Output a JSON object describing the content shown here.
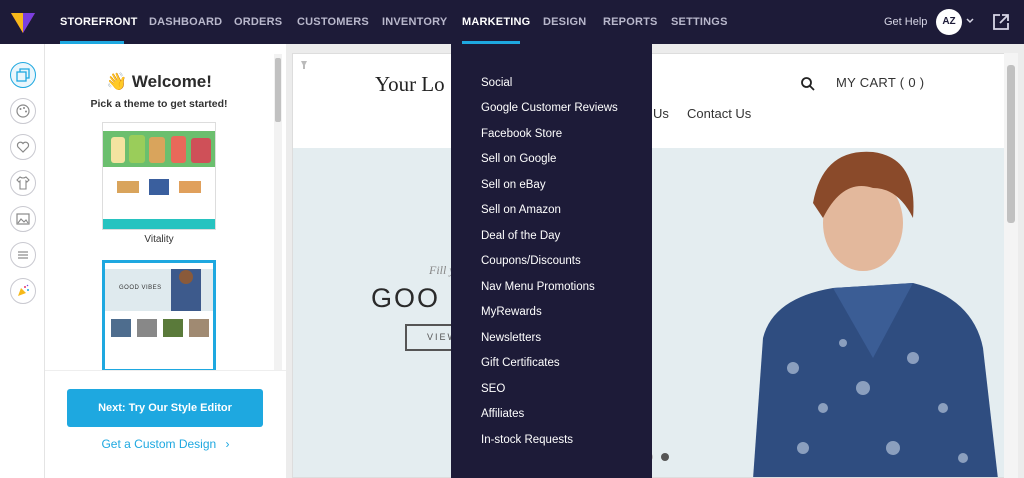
{
  "nav": {
    "items": [
      "STOREFRONT",
      "DASHBOARD",
      "ORDERS",
      "CUSTOMERS",
      "INVENTORY",
      "MARKETING",
      "DESIGN",
      "REPORTS",
      "SETTINGS"
    ],
    "get_help": "Get Help",
    "avatar_initials": "AZ"
  },
  "panel": {
    "welcome": "👋 Welcome!",
    "pick": "Pick a theme to get started!",
    "themes": [
      "Vitality",
      ""
    ],
    "theme1_tagline": "GOOD VIBES",
    "next_button": "Next: Try Our Style Editor",
    "custom_link": "Get a Custom Design",
    "custom_link_arrow": "›"
  },
  "preview": {
    "logo": "Your Lo",
    "cart": "MY CART ( 0 )",
    "nav_us": "Us",
    "nav_contact": "Contact Us",
    "hero_fill": "Fill y",
    "hero_title": "GOO",
    "hero_button": "VIEW"
  },
  "marketing_menu": [
    "Social",
    "Google Customer Reviews",
    "Facebook Store",
    "Sell on Google",
    "Sell on eBay",
    "Sell on Amazon",
    "Deal of the Day",
    "Coupons/Discounts",
    "Nav Menu Promotions",
    "MyRewards",
    "Newsletters",
    "Gift Certificates",
    "SEO",
    "Affiliates",
    "In-stock Requests"
  ],
  "colors": {
    "nav_bg": "#1d1b38",
    "accent": "#1ea8e0"
  }
}
